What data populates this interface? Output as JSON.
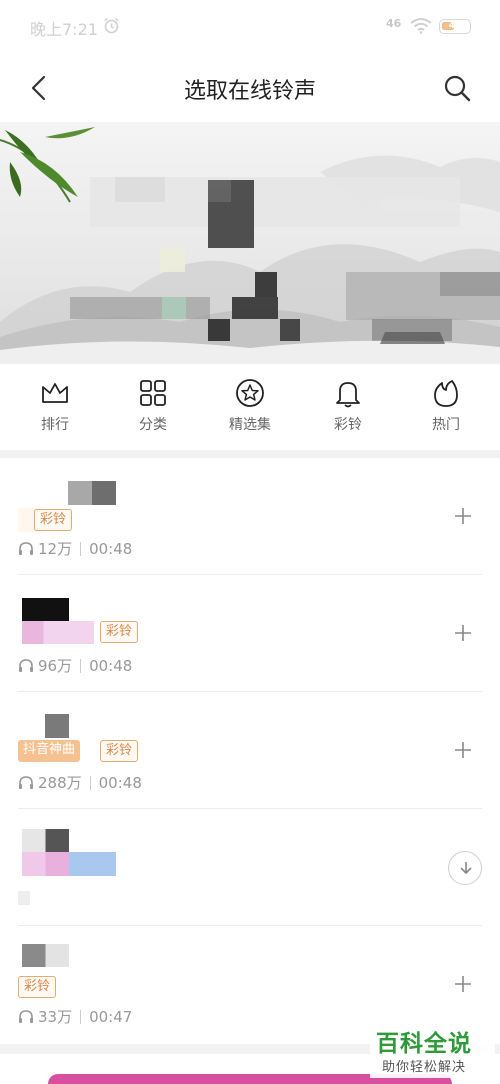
{
  "status_bar": {
    "time": "晚上7:21",
    "signal": "46",
    "battery": "45"
  },
  "header": {
    "title": "选取在线铃声"
  },
  "categories": [
    {
      "label": "排行",
      "icon": "crown-icon"
    },
    {
      "label": "分类",
      "icon": "grid-icon"
    },
    {
      "label": "精选集",
      "icon": "star-circle-icon"
    },
    {
      "label": "彩铃",
      "icon": "bell-icon"
    },
    {
      "label": "热门",
      "icon": "flame-icon"
    }
  ],
  "ringtones": [
    {
      "tags": [
        "彩铃"
      ],
      "plays": "12万",
      "duration": "00:48",
      "action": "add"
    },
    {
      "tags": [
        "神曲",
        "彩铃"
      ],
      "plays": "96万",
      "duration": "00:48",
      "action": "add"
    },
    {
      "tags": [
        "抖音神曲",
        "彩铃"
      ],
      "plays": "288万",
      "duration": "00:48",
      "action": "add"
    },
    {
      "tags": [],
      "plays": "",
      "duration": "",
      "action": "download"
    },
    {
      "tags": [
        "彩铃"
      ],
      "plays": "33万",
      "duration": "00:47",
      "action": "add"
    }
  ],
  "watermark": {
    "title": "百科全说",
    "subtitle": "助你轻松解决"
  },
  "colors": {
    "accent_orange": "#d9894a",
    "tag_orange_fill": "#f5c190",
    "watermark_green": "#2f9a3a"
  }
}
